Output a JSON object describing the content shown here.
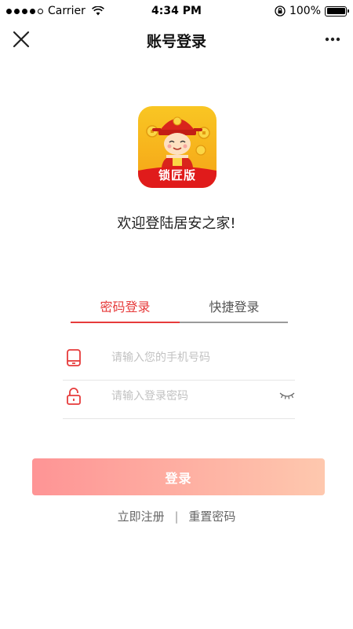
{
  "status_bar": {
    "carrier": "Carrier",
    "time": "4:34 PM",
    "battery_pct": "100%"
  },
  "nav": {
    "title": "账号登录"
  },
  "logo": {
    "badge_text": "锁匠版"
  },
  "welcome_text": "欢迎登陆居安之家!",
  "tabs": [
    {
      "label": "密码登录",
      "active": true
    },
    {
      "label": "快捷登录",
      "active": false
    }
  ],
  "fields": {
    "phone_placeholder": "请输入您的手机号码",
    "password_placeholder": "请输入登录密码"
  },
  "login_button": "登录",
  "links": {
    "register": "立即注册",
    "separator": "|",
    "reset": "重置密码"
  },
  "colors": {
    "accent": "#e63b3b",
    "button_gradient_start": "#fe9495",
    "button_gradient_end": "#fec8ae",
    "logo_yellow": "#f5a417"
  }
}
